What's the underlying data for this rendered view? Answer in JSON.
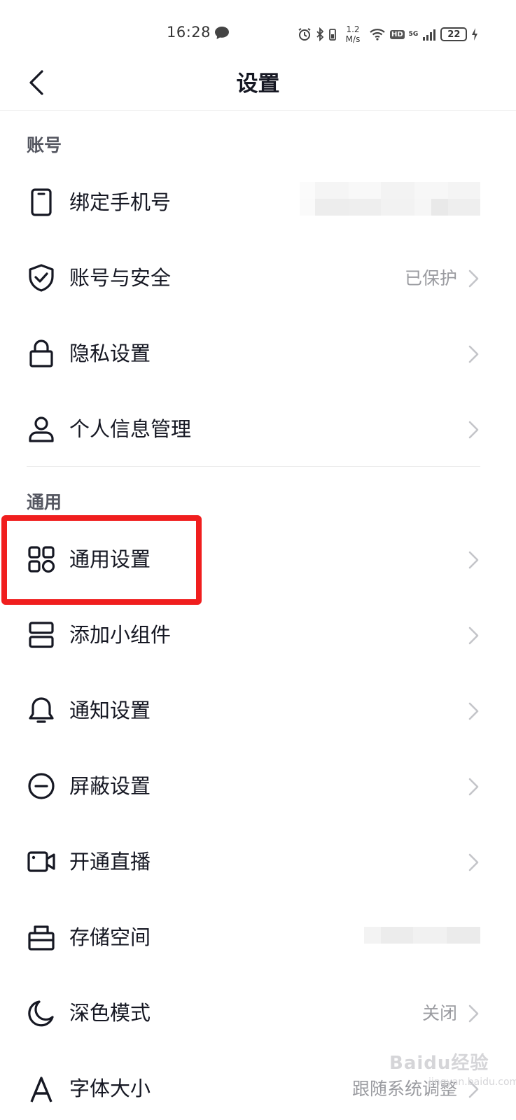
{
  "status_bar": {
    "time": "16:28",
    "speed_value": "1.2",
    "speed_unit": "M/s",
    "hd": "HD",
    "network": "5G",
    "battery": "22"
  },
  "nav": {
    "title": "设置"
  },
  "sections": {
    "account": {
      "header": "账号",
      "items": [
        {
          "label": "绑定手机号",
          "value": "",
          "icon": "phone-icon"
        },
        {
          "label": "账号与安全",
          "value": "已保护",
          "icon": "shield-check-icon"
        },
        {
          "label": "隐私设置",
          "value": "",
          "icon": "lock-icon"
        },
        {
          "label": "个人信息管理",
          "value": "",
          "icon": "person-icon"
        }
      ]
    },
    "general": {
      "header": "通用",
      "items": [
        {
          "label": "通用设置",
          "value": "",
          "icon": "grid-icon"
        },
        {
          "label": "添加小组件",
          "value": "",
          "icon": "widget-icon"
        },
        {
          "label": "通知设置",
          "value": "",
          "icon": "bell-icon"
        },
        {
          "label": "屏蔽设置",
          "value": "",
          "icon": "block-icon"
        },
        {
          "label": "开通直播",
          "value": "",
          "icon": "video-camera-icon"
        },
        {
          "label": "存储空间",
          "value": "",
          "icon": "storage-icon"
        },
        {
          "label": "深色模式",
          "value": "关闭",
          "icon": "moon-icon"
        },
        {
          "label": "字体大小",
          "value": "跟随系统调整",
          "icon": "font-icon"
        }
      ]
    }
  },
  "watermark": {
    "text": "Baidu经验",
    "sub": "jingyan.baidu.com"
  },
  "colors": {
    "highlight": "#f01e1e",
    "text_primary": "#161823",
    "text_secondary": "#9a9ba0",
    "section_header": "#555761"
  }
}
